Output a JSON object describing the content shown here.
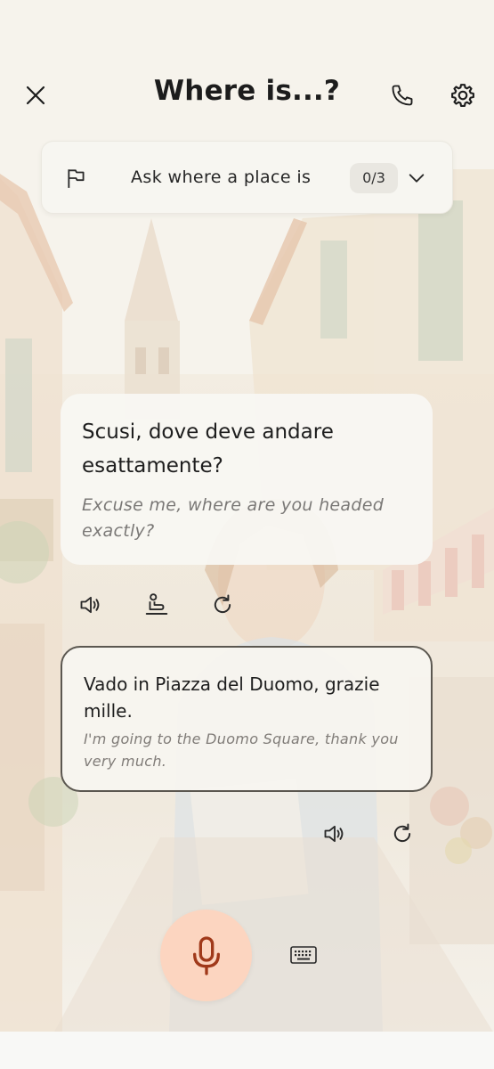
{
  "header": {
    "title": "Where is...?",
    "close_icon": "close-icon",
    "call_icon": "phone-icon",
    "settings_icon": "gear-icon"
  },
  "goal": {
    "icon": "flag-icon",
    "text": "Ask where a place is",
    "progress": "0/3",
    "expand_icon": "chevron-down-icon"
  },
  "assistant_message": {
    "text": "Scusi, dove deve andare esattamente?",
    "translation": "Excuse me, where are you headed exactly?",
    "actions": [
      "speaker-icon",
      "slow-speech-icon",
      "replay-icon"
    ]
  },
  "user_message": {
    "text": "Vado in Piazza del Duomo, grazie mille.",
    "translation": "I'm going to the Duomo Square, thank you very much.",
    "actions": [
      "speaker-icon",
      "replay-icon"
    ]
  },
  "controls": {
    "mic_icon": "microphone-icon",
    "keyboard_icon": "keyboard-icon"
  },
  "colors": {
    "background": "#f8f7f3",
    "mic_button": "#fcd5c0",
    "mic_icon": "#a0391a",
    "user_bubble_border": "#5b5750",
    "translation_text": "#7a7876"
  }
}
